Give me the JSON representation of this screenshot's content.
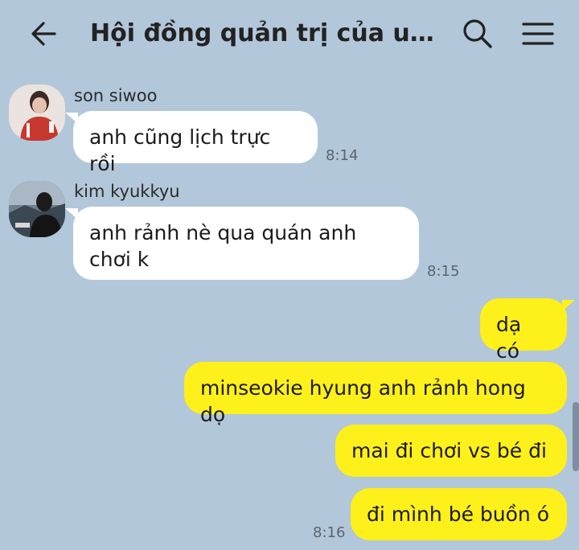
{
  "header": {
    "title": "Hội đồng quản trị của u ch...",
    "back_icon": "arrow-left-icon",
    "search_icon": "search-icon",
    "menu_icon": "hamburger-menu-icon"
  },
  "colors": {
    "background": "#b2c7da",
    "incoming_bubble": "#ffffff",
    "outgoing_bubble": "#fef01b"
  },
  "messages": [
    {
      "sender": "son siwoo",
      "text": "anh cũng lịch trực rồi",
      "time": "8:14",
      "direction": "incoming"
    },
    {
      "sender": "kim kyukkyu",
      "text": "anh rảnh nè qua quán anh chơi k",
      "time": "8:15",
      "direction": "incoming"
    },
    {
      "text": "dạ có",
      "direction": "outgoing"
    },
    {
      "text": "minseokie hyung anh rảnh hong dọ",
      "direction": "outgoing"
    },
    {
      "text": "mai đi chơi vs bé đi",
      "direction": "outgoing"
    },
    {
      "text": "đi mình bé buồn ó",
      "time": "8:16",
      "direction": "outgoing"
    }
  ]
}
